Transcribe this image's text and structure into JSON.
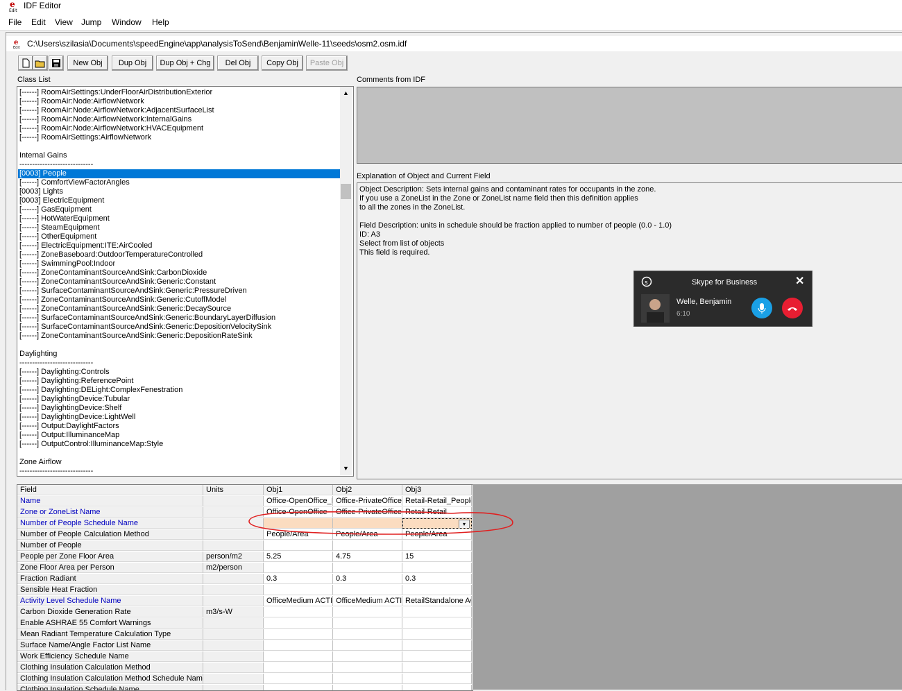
{
  "window": {
    "title": "IDF Editor"
  },
  "menu": [
    "File",
    "Edit",
    "View",
    "Jump",
    "Window",
    "Help"
  ],
  "doc": {
    "path": "C:\\Users\\szilasia\\Documents\\speedEngine\\app\\analysisToSend\\BenjaminWelle-11\\seeds\\osm2.osm.idf"
  },
  "toolbar": {
    "new_obj": "New Obj",
    "dup_obj": "Dup Obj",
    "dup_obj_chg": "Dup Obj + Chg",
    "del_obj": "Del Obj",
    "copy_obj": "Copy Obj",
    "paste_obj": "Paste Obj"
  },
  "class_list": {
    "label": "Class List",
    "rows": [
      "[------]  RoomAirSettings:UnderFloorAirDistributionExterior",
      "[------]  RoomAir:Node:AirflowNetwork",
      "[------]  RoomAir:Node:AirflowNetwork:AdjacentSurfaceList",
      "[------]  RoomAir:Node:AirflowNetwork:InternalGains",
      "[------]  RoomAir:Node:AirflowNetwork:HVACEquipment",
      "[------]  RoomAirSettings:AirflowNetwork",
      "",
      "Internal Gains",
      "-----------------------------",
      "[0003]  People",
      "[------]  ComfortViewFactorAngles",
      "[0003]  Lights",
      "[0003]  ElectricEquipment",
      "[------]  GasEquipment",
      "[------]  HotWaterEquipment",
      "[------]  SteamEquipment",
      "[------]  OtherEquipment",
      "[------]  ElectricEquipment:ITE:AirCooled",
      "[------]  ZoneBaseboard:OutdoorTemperatureControlled",
      "[------]  SwimmingPool:Indoor",
      "[------]  ZoneContaminantSourceAndSink:CarbonDioxide",
      "[------]  ZoneContaminantSourceAndSink:Generic:Constant",
      "[------]  SurfaceContaminantSourceAndSink:Generic:PressureDriven",
      "[------]  ZoneContaminantSourceAndSink:Generic:CutoffModel",
      "[------]  ZoneContaminantSourceAndSink:Generic:DecaySource",
      "[------]  SurfaceContaminantSourceAndSink:Generic:BoundaryLayerDiffusion",
      "[------]  SurfaceContaminantSourceAndSink:Generic:DepositionVelocitySink",
      "[------]  ZoneContaminantSourceAndSink:Generic:DepositionRateSink",
      "",
      "Daylighting",
      "-----------------------------",
      "[------]  Daylighting:Controls",
      "[------]  Daylighting:ReferencePoint",
      "[------]  Daylighting:DELight:ComplexFenestration",
      "[------]  DaylightingDevice:Tubular",
      "[------]  DaylightingDevice:Shelf",
      "[------]  DaylightingDevice:LightWell",
      "[------]  Output:DaylightFactors",
      "[------]  Output:IlluminanceMap",
      "[------]  OutputControl:IlluminanceMap:Style",
      "",
      "Zone Airflow",
      "-----------------------------"
    ],
    "selected_index": 9
  },
  "comments": {
    "label": "Comments from IDF"
  },
  "explanation": {
    "label": "Explanation of Object and Current Field",
    "lines": [
      "Object Description: Sets internal gains and contaminant rates for occupants in the zone.",
      "If you use a ZoneList in the Zone or ZoneList name field then this definition applies",
      "to all the zones in the ZoneList.",
      "",
      "Field Description:  units in schedule should be fraction applied to number of people (0.0 - 1.0)",
      "ID: A3",
      "Select from list of objects",
      "This field is required."
    ]
  },
  "grid": {
    "headers": [
      "Field",
      "Units",
      "Obj1",
      "Obj2",
      "Obj3"
    ],
    "rows": [
      {
        "field": "Name",
        "units": "",
        "v": [
          "Office-OpenOffice_People",
          "Office-PrivateOffice_People",
          "Retail-Retail_People"
        ],
        "blue": true
      },
      {
        "field": "Zone or ZoneList Name",
        "units": "",
        "v": [
          "Office-OpenOffice",
          "Office-PrivateOffice",
          "Retail-Retail"
        ],
        "blue": true
      },
      {
        "field": "Number of People Schedule Name",
        "units": "",
        "v": [
          "",
          "",
          ""
        ],
        "blue": true
      },
      {
        "field": "Number of People Calculation Method",
        "units": "",
        "v": [
          "People/Area",
          "People/Area",
          "People/Area"
        ],
        "blue": false
      },
      {
        "field": "Number of People",
        "units": "",
        "v": [
          "",
          "",
          ""
        ],
        "blue": false
      },
      {
        "field": "People per Zone Floor Area",
        "units": "person/m2",
        "v": [
          "5.25",
          "4.75",
          "15"
        ],
        "blue": false
      },
      {
        "field": "Zone Floor Area per Person",
        "units": "m2/person",
        "v": [
          "",
          "",
          ""
        ],
        "blue": false
      },
      {
        "field": "Fraction Radiant",
        "units": "",
        "v": [
          "0.3",
          "0.3",
          "0.3"
        ],
        "blue": false
      },
      {
        "field": "Sensible Heat Fraction",
        "units": "",
        "v": [
          "",
          "",
          ""
        ],
        "blue": false
      },
      {
        "field": "Activity Level Schedule Name",
        "units": "",
        "v": [
          "OfficeMedium ACTIVITY_SCH",
          "OfficeMedium ACTIVITY_SCH",
          "RetailStandalone ACTIVITY_SCH"
        ],
        "blue": true
      },
      {
        "field": "Carbon Dioxide Generation Rate",
        "units": "m3/s-W",
        "v": [
          "",
          "",
          ""
        ],
        "blue": false
      },
      {
        "field": "Enable ASHRAE 55 Comfort Warnings",
        "units": "",
        "v": [
          "",
          "",
          ""
        ],
        "blue": false
      },
      {
        "field": "Mean Radiant Temperature Calculation Type",
        "units": "",
        "v": [
          "",
          "",
          ""
        ],
        "blue": false
      },
      {
        "field": "Surface Name/Angle Factor List Name",
        "units": "",
        "v": [
          "",
          "",
          ""
        ],
        "blue": false
      },
      {
        "field": "Work Efficiency Schedule Name",
        "units": "",
        "v": [
          "",
          "",
          ""
        ],
        "blue": false
      },
      {
        "field": "Clothing Insulation Calculation Method",
        "units": "",
        "v": [
          "",
          "",
          ""
        ],
        "blue": false
      },
      {
        "field": "Clothing Insulation Calculation Method Schedule Name",
        "units": "",
        "v": [
          "",
          "",
          ""
        ],
        "blue": false
      },
      {
        "field": "Clothing Insulation Schedule Name",
        "units": "",
        "v": [
          "",
          "",
          ""
        ],
        "blue": false
      }
    ]
  },
  "skype": {
    "title": "Skype for Business",
    "name": "Welle, Benjamin",
    "time": "6:10"
  },
  "colors": {
    "selection": "#0078d7",
    "highlight_cell": "#fbdcc0",
    "annotation": "#e02020"
  }
}
